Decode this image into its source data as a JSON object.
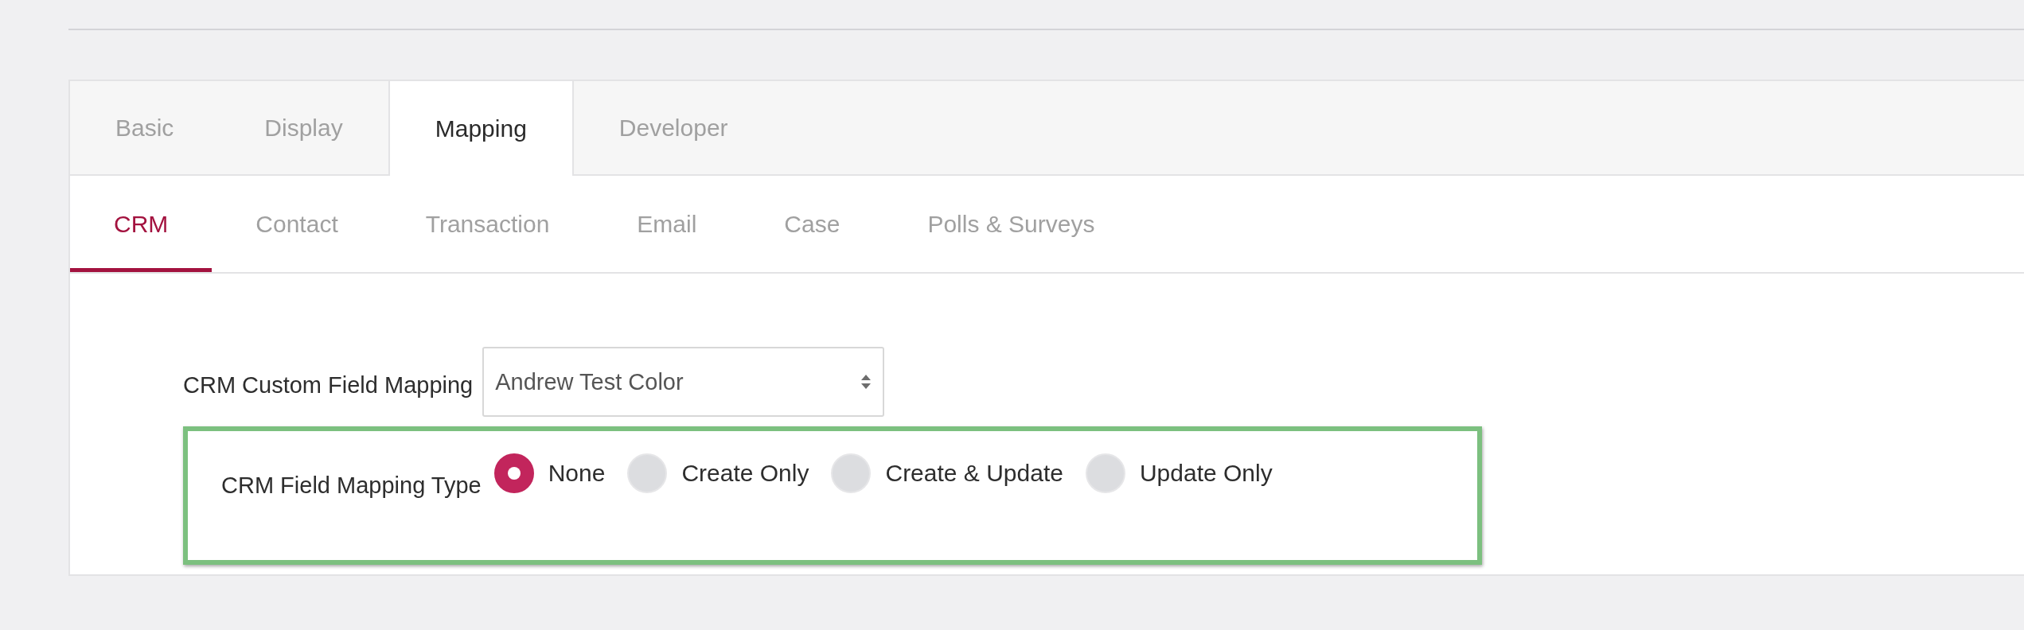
{
  "main_tabs": [
    {
      "label": "Basic",
      "selected": false
    },
    {
      "label": "Display",
      "selected": false
    },
    {
      "label": "Mapping",
      "selected": true
    },
    {
      "label": "Developer",
      "selected": false
    }
  ],
  "sub_tabs": [
    {
      "label": "CRM",
      "selected": true
    },
    {
      "label": "Contact",
      "selected": false
    },
    {
      "label": "Transaction",
      "selected": false
    },
    {
      "label": "Email",
      "selected": false
    },
    {
      "label": "Case",
      "selected": false
    },
    {
      "label": "Polls & Surveys",
      "selected": false
    }
  ],
  "custom_field_mapping": {
    "label": "CRM Custom Field Mapping",
    "value": "Andrew Test Color"
  },
  "field_mapping_type": {
    "label": "CRM Field Mapping Type",
    "options": [
      {
        "label": "None",
        "selected": true
      },
      {
        "label": "Create Only",
        "selected": false
      },
      {
        "label": "Create & Update",
        "selected": false
      },
      {
        "label": "Update Only",
        "selected": false
      }
    ]
  }
}
